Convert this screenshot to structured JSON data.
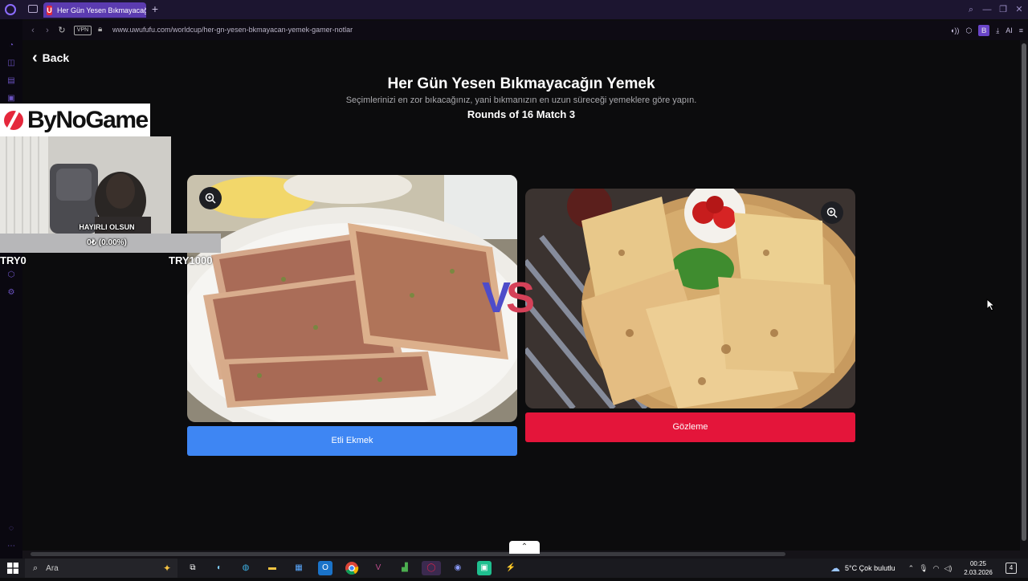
{
  "browser": {
    "tab_title": "Her Gün Yesen Bıkmayacağın Yemek - uwufufu",
    "tab_favicon_letter": "U",
    "new_tab_symbol": "+",
    "vpn_label": "VPN",
    "url": "www.uwufufu.com/worldcup/her-gn-yesen-bkmayacan-yemek-gamer-notlar",
    "profile_badge": "B",
    "ai_label": "AI"
  },
  "page": {
    "back_label": "Back",
    "title": "Her Gün Yesen Bıkmayacağın Yemek",
    "subtitle": "Seçimlerinizi en zor bıkacağınız, yani bıkmanızın en uzun süreceği yemeklere göre yapın.",
    "round": "Rounds of 16 Match 3",
    "vs_v": "V",
    "vs_s": "S",
    "left_choice": "Etli Ekmek",
    "right_choice": "Gözleme",
    "colors": {
      "left_button": "#3e86f3",
      "right_button": "#e4153a",
      "background": "#0c0c0d"
    }
  },
  "overlay": {
    "sponsor_logo_text": "ByNoGame",
    "donation_title": "HAYIRLI OLSUN",
    "donation_progress": "0₺ (0.00%)",
    "donation_progress_fraction": 0,
    "donation_min": "TRY0",
    "donation_max": "TRY1000"
  },
  "taskbar": {
    "search_placeholder": "Ara",
    "weather": "5°C  Çok bulutlu",
    "time": "00:25",
    "date": "2.03.2026",
    "notification_count": "4"
  },
  "icons": [
    "opera-icon",
    "tabs-icon",
    "back-icon",
    "forward-icon",
    "reload-icon",
    "lock-icon",
    "zoom-icon",
    "search-icon",
    "windows-icon",
    "discord-icon",
    "chrome-icon",
    "cloud-icon",
    "speaker-icon",
    "wifi-icon"
  ]
}
